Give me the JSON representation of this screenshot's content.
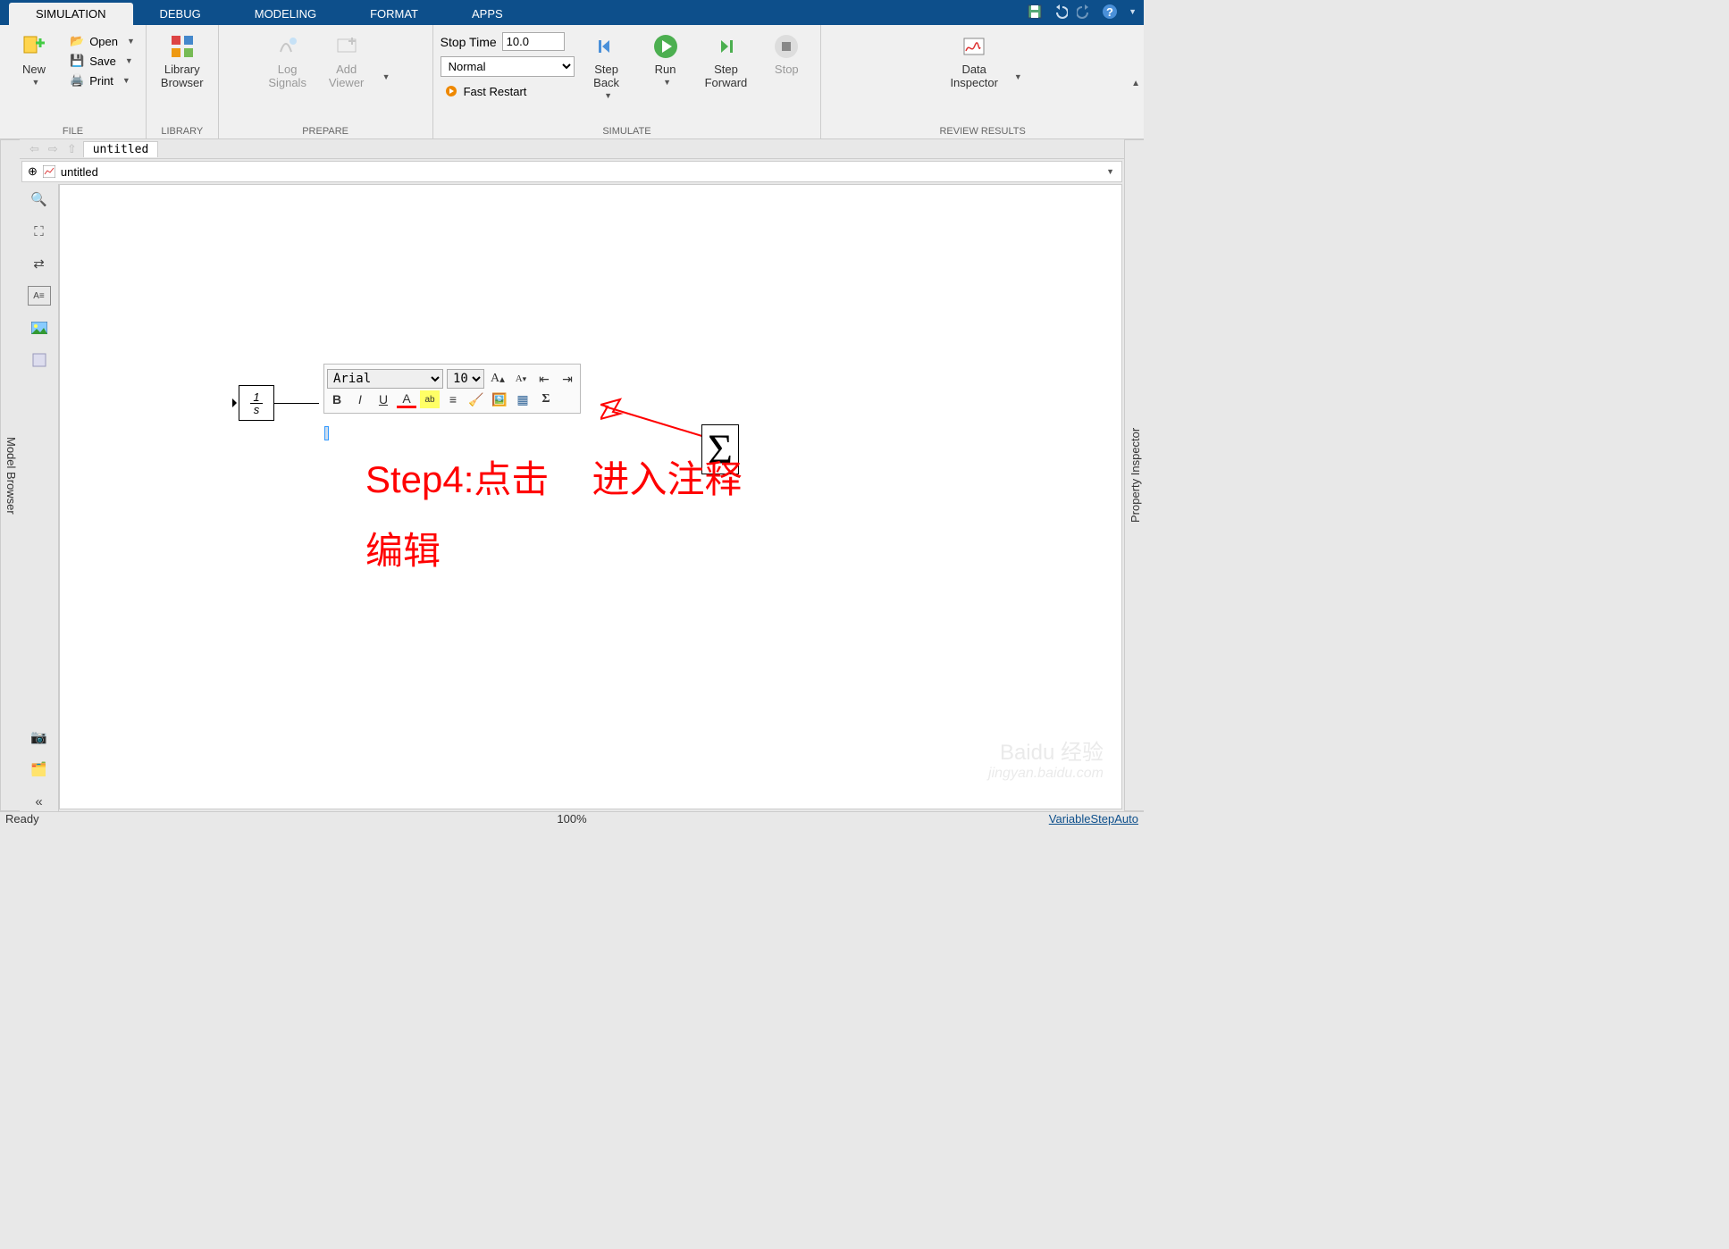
{
  "tabs": {
    "simulation": "SIMULATION",
    "debug": "DEBUG",
    "modeling": "MODELING",
    "format": "FORMAT",
    "apps": "APPS"
  },
  "file": {
    "new": "New",
    "open": "Open",
    "save": "Save",
    "print": "Print",
    "label": "FILE"
  },
  "library": {
    "browser": "Library\nBrowser",
    "label": "LIBRARY"
  },
  "prepare": {
    "log": "Log\nSignals",
    "viewer": "Add\nViewer",
    "label": "PREPARE"
  },
  "sim": {
    "stoptime_label": "Stop Time",
    "stoptime_value": "10.0",
    "mode": "Normal",
    "fastrestart": "Fast Restart",
    "stepback": "Step\nBack",
    "run": "Run",
    "stepfwd": "Step\nForward",
    "stop": "Stop",
    "label": "SIMULATE"
  },
  "review": {
    "inspector": "Data\nInspector",
    "label": "REVIEW RESULTS"
  },
  "model": {
    "tab": "untitled",
    "breadcrumb": "untitled"
  },
  "sidepanels": {
    "left": "Model Browser",
    "right": "Property Inspector"
  },
  "fmtbar": {
    "font": "Arial",
    "size": "10"
  },
  "annotation": {
    "line1": "Step4:点击",
    "line1b": "进入注释",
    "line2": "编辑"
  },
  "status": {
    "ready": "Ready",
    "zoom": "100%",
    "solver": "VariableStepAuto"
  },
  "watermark": {
    "main": "Baidu 经验",
    "sub": "jingyan.baidu.com"
  }
}
